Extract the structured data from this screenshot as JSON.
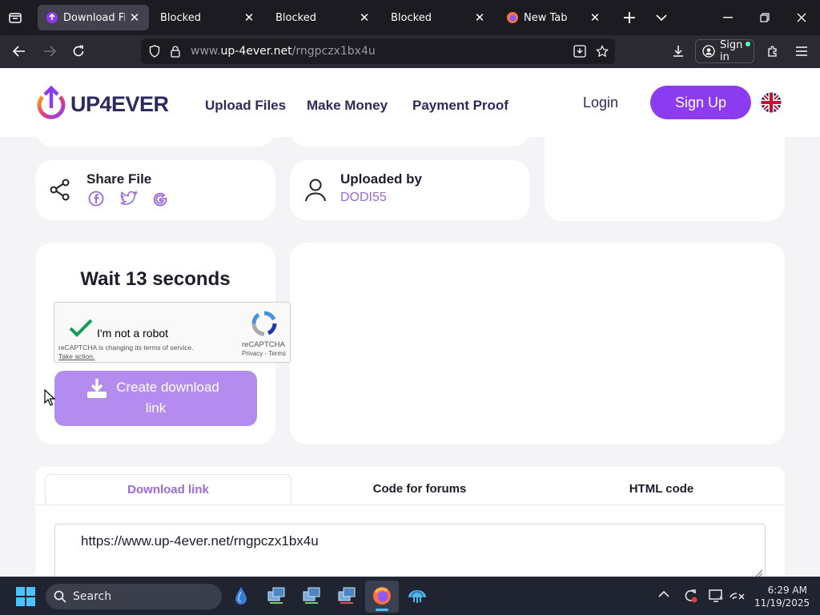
{
  "browser": {
    "tabs": [
      {
        "label": "Download File P",
        "icon": "up4ever-favicon",
        "active": true
      },
      {
        "label": "Blocked",
        "icon": "none",
        "active": false
      },
      {
        "label": "Blocked",
        "icon": "none",
        "active": false
      },
      {
        "label": "Blocked",
        "icon": "none",
        "active": false
      },
      {
        "label": "New Tab",
        "icon": "firefox-icon",
        "active": false
      }
    ],
    "url_prefix": "www.",
    "url_domain": "up-4ever.net",
    "url_path": "/rngpczx1bx4u",
    "sign_in_label": "Sign in"
  },
  "site": {
    "logo_text": "UP4EVER",
    "nav": {
      "upload": "Upload Files",
      "money": "Make Money",
      "proof": "Payment Proof"
    },
    "login_label": "Login",
    "signup_label": "Sign Up",
    "share": {
      "title": "Share File"
    },
    "uploader": {
      "title": "Uploaded by",
      "name": "DODI55"
    },
    "wait_text": "Wait 13 seconds",
    "captcha": {
      "label": "I'm not a robot",
      "notice": "reCAPTCHA is changing its terms of service.",
      "action": "Take action.",
      "brand": "reCAPTCHA",
      "privacy": "Privacy",
      "sep": " - ",
      "terms": "Terms"
    },
    "create_button": {
      "line1": "Create download",
      "line2": "link"
    },
    "tabs": {
      "download": "Download link",
      "forums": "Code for forums",
      "html": "HTML code"
    },
    "link_value": "https://www.up-4ever.net/rngpczx1bx4u"
  },
  "taskbar": {
    "search_label": "Search",
    "time": "6:29 AM",
    "date": "11/19/2025"
  },
  "colors": {
    "brand_purple": "#8c3cf0",
    "button_lilac": "#b48cf0",
    "nav_text": "#2d2a5e",
    "link_purple": "#9b6ad8"
  }
}
